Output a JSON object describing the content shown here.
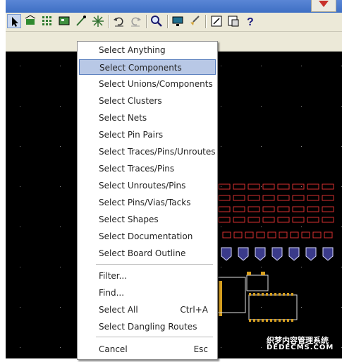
{
  "toolbar": {
    "buttons": [
      "select-arrow-icon",
      "add-component-icon",
      "grid-icon",
      "board-icon",
      "route-icon",
      "spark-icon",
      "undo-icon",
      "redo-icon",
      "zoom-icon",
      "monitor-icon",
      "brush-icon",
      "window-icon",
      "clipboard-icon",
      "help-icon"
    ],
    "help_glyph": "?"
  },
  "menu": {
    "items": [
      {
        "label": "Select Anything"
      },
      {
        "label": "Select Components",
        "highlighted": true
      },
      {
        "label": "Select Unions/Components"
      },
      {
        "label": "Select Clusters"
      },
      {
        "label": "Select Nets"
      },
      {
        "label": "Select Pin Pairs"
      },
      {
        "label": "Select Traces/Pins/Unroutes"
      },
      {
        "label": "Select Traces/Pins"
      },
      {
        "label": "Select Unroutes/Pins"
      },
      {
        "label": "Select Pins/Vias/Tacks"
      },
      {
        "label": "Select Shapes"
      },
      {
        "label": "Select Documentation"
      },
      {
        "label": "Select Board Outline"
      },
      {
        "label": "Filter..."
      },
      {
        "label": "Find..."
      },
      {
        "label": "Select All",
        "shortcut": "Ctrl+A"
      },
      {
        "label": "Select Dangling Routes"
      },
      {
        "label": "Cancel",
        "shortcut": "Esc"
      }
    ]
  },
  "watermark": {
    "line1": "织梦内容管理系统",
    "line2": "DEDECMS.COM"
  },
  "colors": {
    "canvas": "#000000",
    "highlight": "#b8c8e6",
    "component": "#e03030"
  }
}
